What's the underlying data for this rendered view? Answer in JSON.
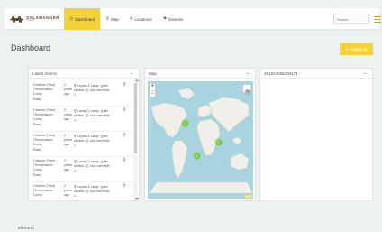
{
  "header": {
    "logo_text": "SALAMANDER",
    "logo_sub": "TRUST",
    "nav": [
      {
        "label": "Dashboard",
        "icon": "dashboard-icon",
        "glyph": "◴",
        "active": true
      },
      {
        "label": "Map",
        "icon": "map-pin-icon",
        "glyph": "⚲",
        "active": false
      },
      {
        "label": "Locations",
        "icon": "location-pin-icon",
        "glyph": "⚲",
        "active": false
      },
      {
        "label": "Devices",
        "icon": "device-icon",
        "glyph": "⚑",
        "active": false
      }
    ],
    "search_placeholder": "Search"
  },
  "page": {
    "title": "Dashboard",
    "configure_label": "✎ Configure"
  },
  "alarms_panel": {
    "title": "Latest Alarms",
    "rows": [
      {
        "name": [
          "Chlorine (Free)",
          "(Temperature-Comp",
          "Raw)"
        ],
        "time": [
          "2",
          "years",
          "ago"
        ],
        "location": [
          "Leylan-2 camp. (pest",
          "section-II), row: borehole",
          "1"
        ]
      },
      {
        "name": [
          "Chlorine (Free)",
          "(Temperature-Comp",
          "Raw)"
        ],
        "time": [
          "2",
          "years",
          "ago"
        ],
        "location": [
          "Leylan-2 camp. (pest",
          "section-II), row: borehole",
          "1"
        ]
      },
      {
        "name": [
          "Chlorine (Free)",
          "(Temperature-Comp",
          "Raw)"
        ],
        "time": [
          "2",
          "years",
          "ago"
        ],
        "location": [
          "Leylan-2 camp. (pest",
          "section-II), row: borehole",
          "1"
        ]
      },
      {
        "name": [
          "Chlorine (Free)",
          "(Temperature-Comp",
          "Raw)"
        ],
        "time": [
          "2",
          "years",
          "ago"
        ],
        "location": [
          "Leylan-2 camp. (pest",
          "section-II), row: borehole",
          "1"
        ]
      },
      {
        "name": [
          "Chlorine (Free)",
          "(Temperature-Comp",
          "Raw)"
        ],
        "time": [
          "2",
          "years",
          "ago"
        ],
        "location": [
          "Leylan-2 camp. (pest",
          "section-II), row: borehole",
          "1"
        ]
      }
    ]
  },
  "map_panel": {
    "title": "Map",
    "zoom_in": "+",
    "zoom_out": "−",
    "clusters": [
      "4",
      "2",
      "3"
    ]
  },
  "device_panel": {
    "title": "351924065200174"
  },
  "footer": {
    "label": "element"
  },
  "colors": {
    "accent": "#f4d23b",
    "background": "#edf1f2",
    "ocean": "#a9d3df",
    "land": "#f1efe9",
    "cluster": "#6ecc39"
  }
}
